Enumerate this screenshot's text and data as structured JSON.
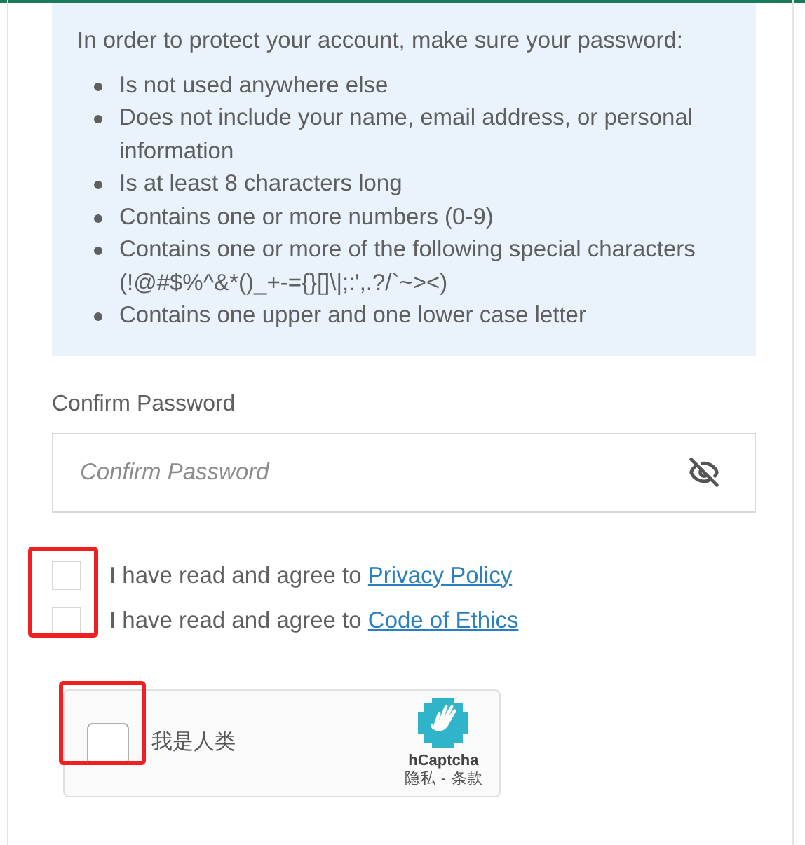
{
  "requirements": {
    "intro": "In order to protect your account, make sure your password:",
    "items": [
      "Is not used anywhere else",
      "Does not include your name, email address, or personal information",
      "Is at least 8 characters long",
      "Contains one or more numbers (0-9)",
      "Contains one or more of the following special characters (!@#$%^&*()_+-={}[]\\|;:',.?/`~><)",
      "Contains one upper and one lower case letter"
    ]
  },
  "confirm_password": {
    "label": "Confirm Password",
    "placeholder": "Confirm Password"
  },
  "agreements": [
    {
      "text": "I have read and agree to",
      "link": "Privacy Policy",
      "checked": false
    },
    {
      "text": "I have read and agree to",
      "link": "Code of Ethics",
      "checked": false
    }
  ],
  "captcha": {
    "label": "我是人类",
    "checked": false,
    "brand": "hCaptcha",
    "privacy": "隐私",
    "separator": "-",
    "terms": "条款"
  }
}
